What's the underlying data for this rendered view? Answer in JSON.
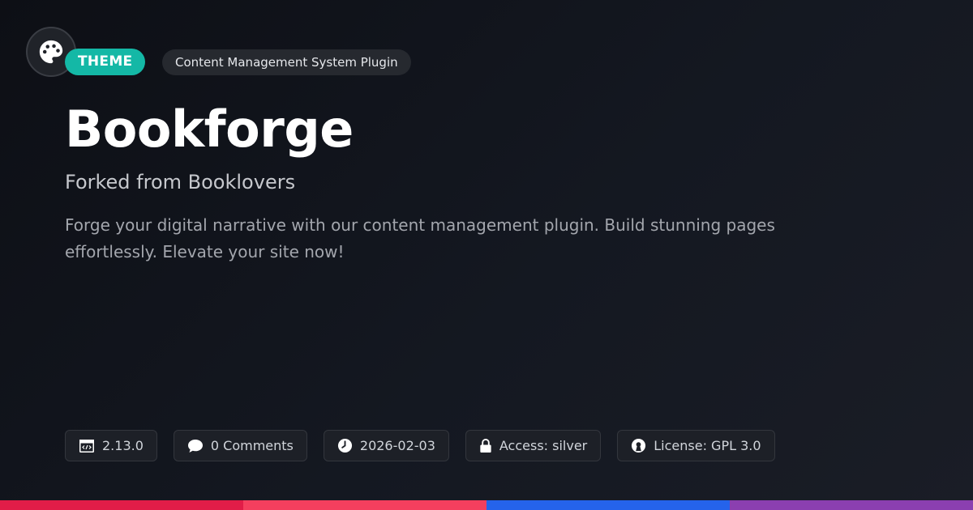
{
  "header": {
    "logo_icon": "palette-icon",
    "badge_theme": "THEME",
    "badge_category": "Content Management System Plugin"
  },
  "main": {
    "title": "Bookforge",
    "subtitle": "Forked from Booklovers",
    "description": "Forge your digital narrative with our content management plugin. Build stunning pages effortlessly. Elevate your site now!"
  },
  "meta": {
    "version": {
      "icon": "code-icon",
      "label": "2.13.0"
    },
    "comments": {
      "icon": "comment-icon",
      "label": "0 Comments"
    },
    "date": {
      "icon": "clock-icon",
      "label": "2026-02-03"
    },
    "access": {
      "icon": "lock-icon",
      "label": "Access: silver"
    },
    "license": {
      "icon": "open-source-icon",
      "label": "License: GPL 3.0"
    }
  },
  "colors": {
    "accent_teal": "#14b8a6",
    "stripe": [
      "#e11d48",
      "#f43f5e",
      "#2563eb",
      "#8b3fb0"
    ]
  }
}
